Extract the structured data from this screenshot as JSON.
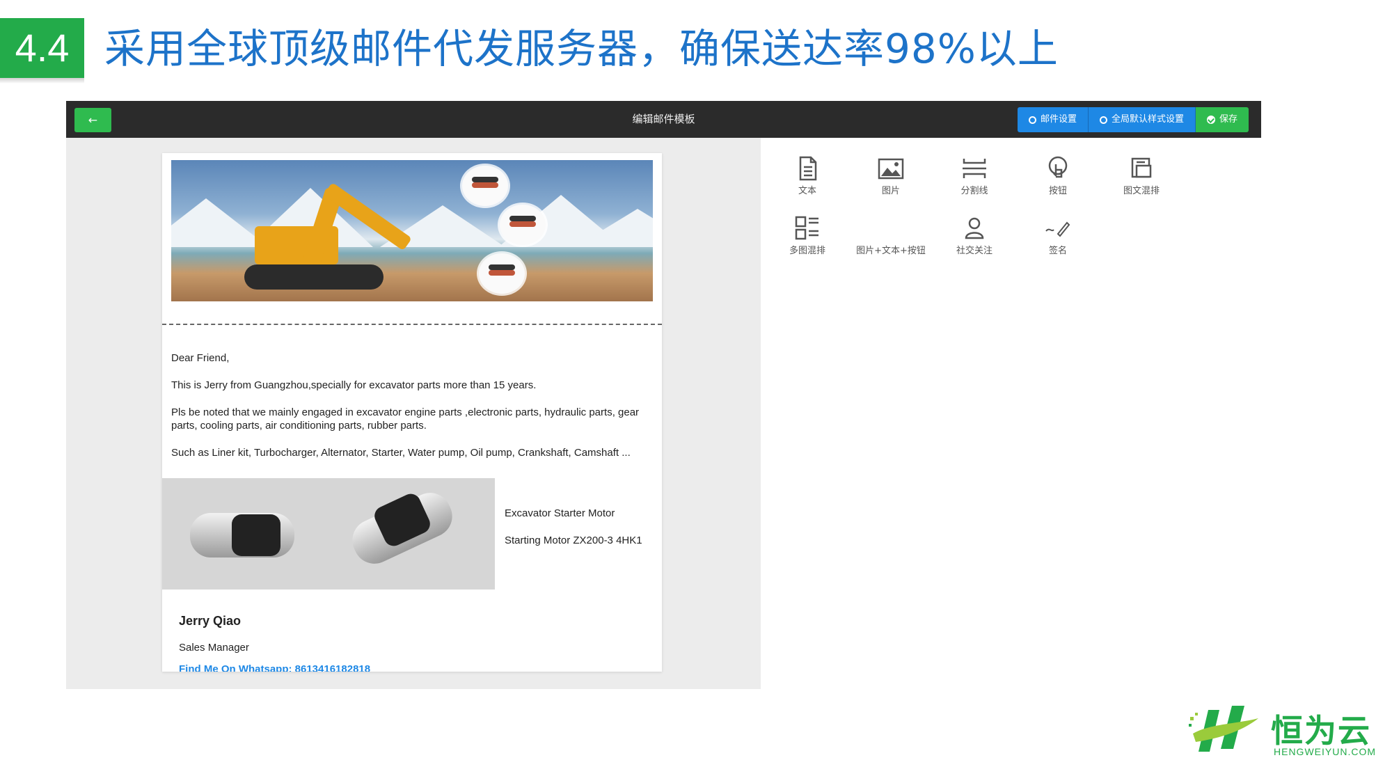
{
  "slide": {
    "section_number": "4.4",
    "title": "采用全球顶级邮件代发服务器，确保送达率98%以上"
  },
  "editor": {
    "back_label": "←",
    "title": "编辑邮件模板",
    "buttons": {
      "mail_settings": "邮件设置",
      "global_style": "全局默认样式设置",
      "save": "保存"
    }
  },
  "email": {
    "greeting": "Dear Friend,",
    "para1": "This is Jerry from Guangzhou,specially for excavator parts more than 15 years.",
    "para2": "Pls be noted that we mainly engaged in excavator engine parts ,electronic parts, hydraulic parts, gear parts, cooling parts, air conditioning parts, rubber parts.",
    "para3": "Such as Liner kit, Turbocharger, Alternator, Starter, Water pump, Oil pump, Crankshaft, Camshaft ...",
    "caption_title": "Excavator Starter Motor",
    "caption_model": "Starting Motor ZX200-3 4HK1",
    "sig_name": "Jerry Qiao",
    "sig_role": "Sales Manager",
    "sig_link": "Find Me On Whatsapp: 8613416182818"
  },
  "tools": {
    "text": "文本",
    "image": "图片",
    "divider": "分割线",
    "button": "按钮",
    "image_text": "图文混排",
    "multi_image": "多图混排",
    "image_text_button": "图片+文本+按钮",
    "social": "社交关注",
    "signature": "签名"
  },
  "logo": {
    "name": "恒为云",
    "domain": "HENGWEIYUN.COM"
  },
  "colors": {
    "brand_green": "#23ab4a",
    "title_blue": "#1d73c9",
    "toolbar_dark": "#2b2b2b",
    "button_blue": "#1e88e5",
    "button_green": "#2fbb4f"
  }
}
